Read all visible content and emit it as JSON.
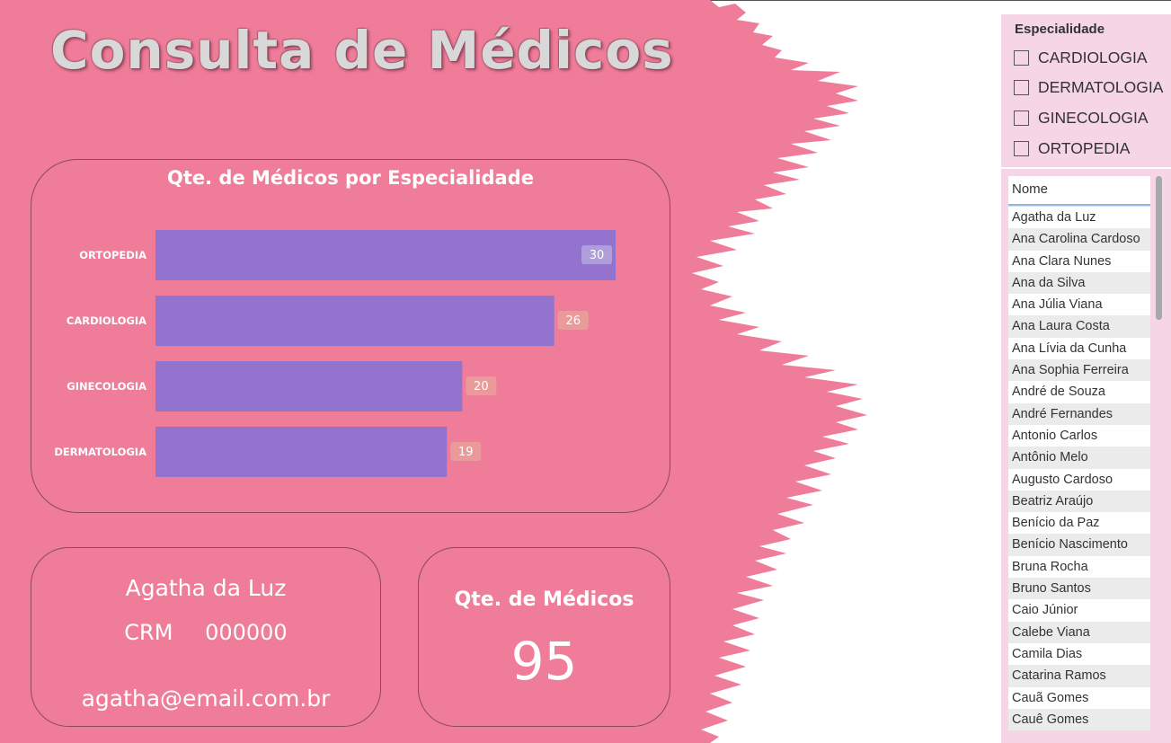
{
  "page": {
    "title": "Consulta de Médicos",
    "colors": {
      "background_pink": "#ef7c98",
      "bar": "#9373cd",
      "label_box": "#eb9a9c",
      "slicer_bg": "#f6d5e7"
    }
  },
  "chart": {
    "title": "Qte. de Médicos por Especialidade"
  },
  "chart_data": {
    "type": "bar",
    "orientation": "horizontal",
    "title": "Qte. de Médicos por Especialidade",
    "categories": [
      "ORTOPEDIA",
      "CARDIOLOGIA",
      "GINECOLOGIA",
      "DERMATOLOGIA"
    ],
    "values": [
      30,
      26,
      20,
      19
    ],
    "xlim": [
      0,
      30
    ],
    "grid": false,
    "bar_color": "#9373cd"
  },
  "doctor_card": {
    "name": "Agatha da Luz",
    "crm_label": "CRM",
    "crm_value": "000000",
    "email": "agatha@email.com.br"
  },
  "count_card": {
    "label": "Qte. de Médicos",
    "value": "95"
  },
  "slicer": {
    "title": "Especialidade",
    "options": [
      "CARDIOLOGIA",
      "DERMATOLOGIA",
      "GINECOLOGIA",
      "ORTOPEDIA"
    ]
  },
  "names_list": {
    "header": "Nome",
    "items": [
      "Agatha da Luz",
      "Ana Carolina Cardoso",
      "Ana Clara Nunes",
      "Ana da Silva",
      "Ana Júlia Viana",
      "Ana Laura Costa",
      "Ana Lívia da Cunha",
      "Ana Sophia Ferreira",
      "André de Souza",
      "André Fernandes",
      "Antonio Carlos",
      "Antônio Melo",
      "Augusto Cardoso",
      "Beatriz Araújo",
      "Benício da Paz",
      "Benício Nascimento",
      "Bruna Rocha",
      "Bruno Santos",
      "Caio Júnior",
      "Calebe Viana",
      "Camila Dias",
      "Catarina Ramos",
      "Cauã Gomes",
      "Cauê Gomes"
    ]
  }
}
